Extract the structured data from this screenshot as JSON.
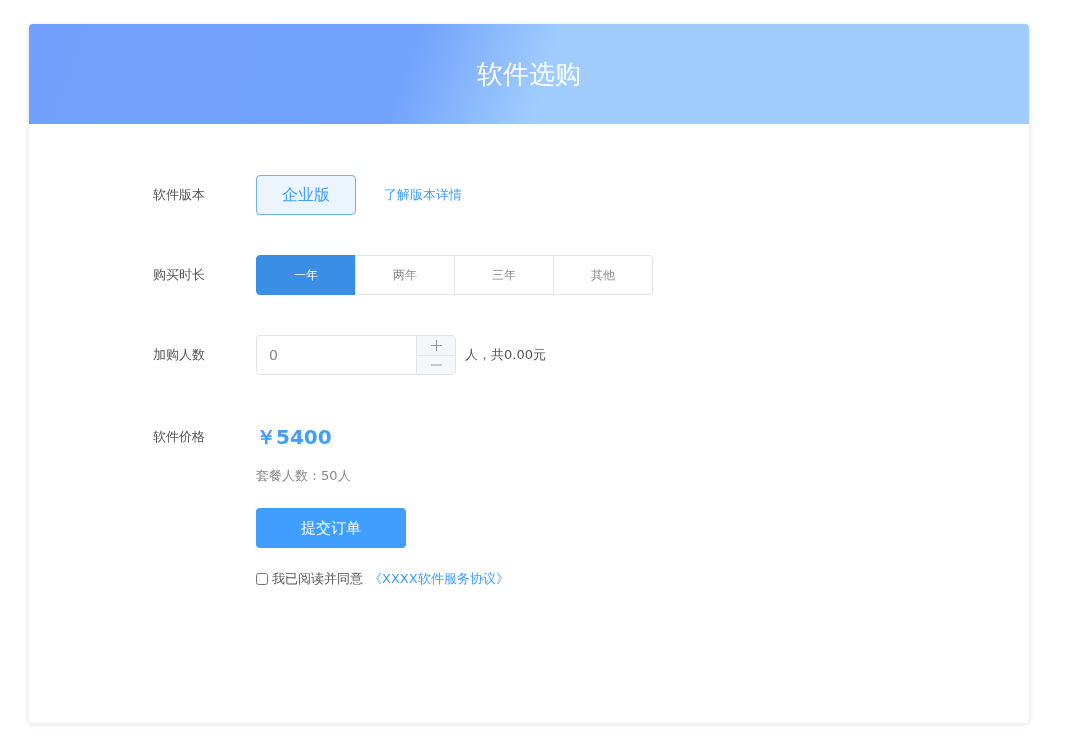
{
  "title": "软件选购",
  "version": {
    "label": "软件版本",
    "options": [
      {
        "label": "企业版",
        "selected": true
      }
    ],
    "link": "了解版本详情"
  },
  "duration": {
    "label": "购买时长",
    "options": [
      {
        "label": "一年",
        "selected": true
      },
      {
        "label": "两年",
        "selected": false
      },
      {
        "label": "三年",
        "selected": false
      },
      {
        "label": "其他",
        "selected": false
      }
    ]
  },
  "extra_users": {
    "label": "加购人数",
    "value": "0",
    "suffix": "人，共0.00元"
  },
  "price": {
    "label": "软件价格",
    "amount": "￥5400",
    "note": "套餐人数：50人"
  },
  "submit": "提交订单",
  "agreement": {
    "checked": false,
    "text": "我已阅读并同意",
    "link": "《XXXX软件服务协议》"
  }
}
